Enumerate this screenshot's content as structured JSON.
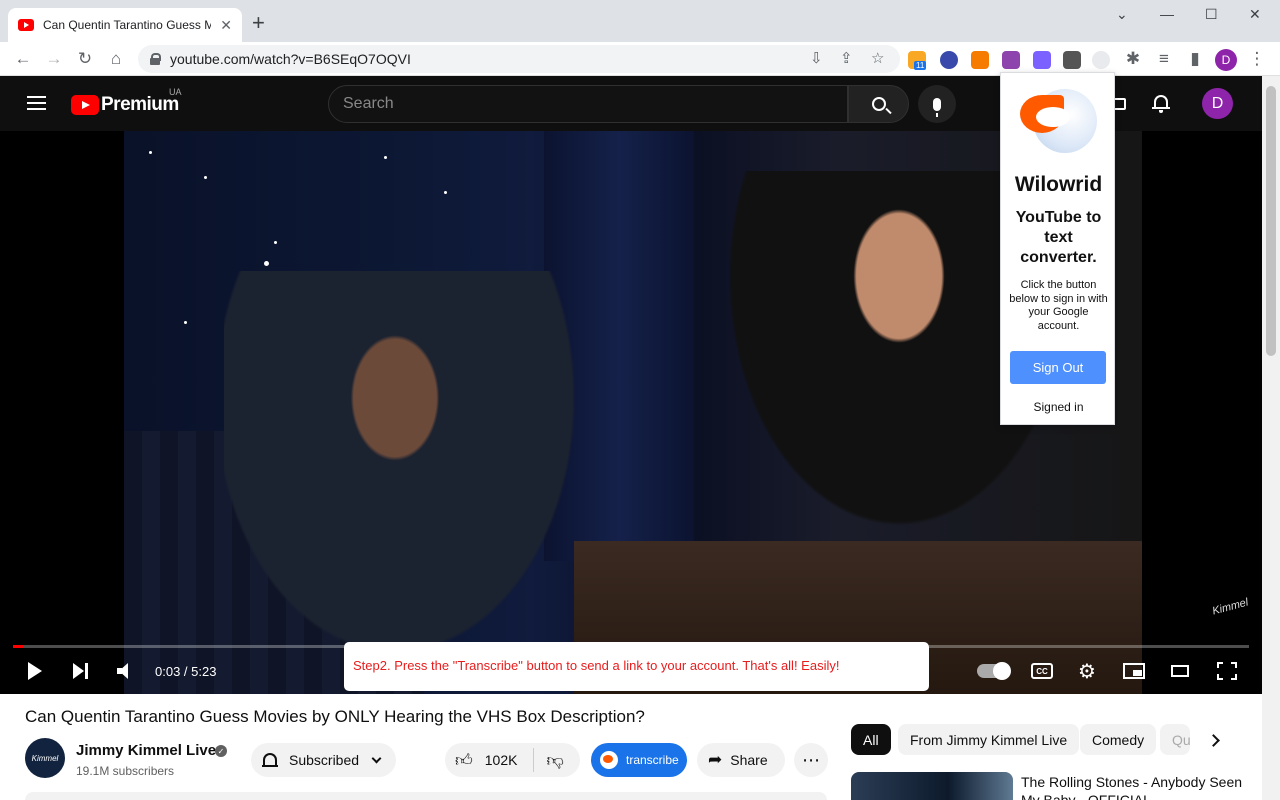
{
  "browser": {
    "tab_title": "Can Quentin Tarantino Guess Mo",
    "url": "youtube.com/watch?v=B6SEqO7OQVI",
    "ext_badge": "11",
    "profile_initial": "D"
  },
  "header": {
    "brand": "Premium",
    "region": "UA",
    "search_placeholder": "Search",
    "avatar_initial": "D"
  },
  "player": {
    "time": "0:03 / 5:23",
    "progress_fraction": 0.009,
    "cc_label": "CC",
    "watermark": "Kimmel",
    "tooltip": "Step2. Press the \"Transcribe\" button to send a link to your account. That's all!  Easily!"
  },
  "popup": {
    "name": "Wilowrid",
    "tagline": "YouTube to text converter.",
    "hint": "Click the button below to sign in with your Google account.",
    "button": "Sign Out",
    "status": "Signed in"
  },
  "video": {
    "title": "Can Quentin Tarantino Guess Movies by ONLY Hearing the VHS Box Description?",
    "channel": "Jimmy Kimmel Live",
    "channel_avatar_text": "Kimmel",
    "subscribers": "19.1M subscribers",
    "subscribed_label": "Subscribed",
    "likes": "102K",
    "transcribe_label": "transcribe",
    "share_label": "Share"
  },
  "chips": [
    "All",
    "From Jimmy Kimmel Live",
    "Comedy",
    "Qu"
  ],
  "recommendation": {
    "title": "The Rolling Stones - Anybody Seen My Baby - OFFICIAL"
  },
  "colors": {
    "yt_red": "#ff0000",
    "popup_button": "#4d90fe",
    "transcribe_button": "#1a73e8",
    "tooltip_text": "#e81d1d",
    "avatar": "#8e24aa"
  }
}
